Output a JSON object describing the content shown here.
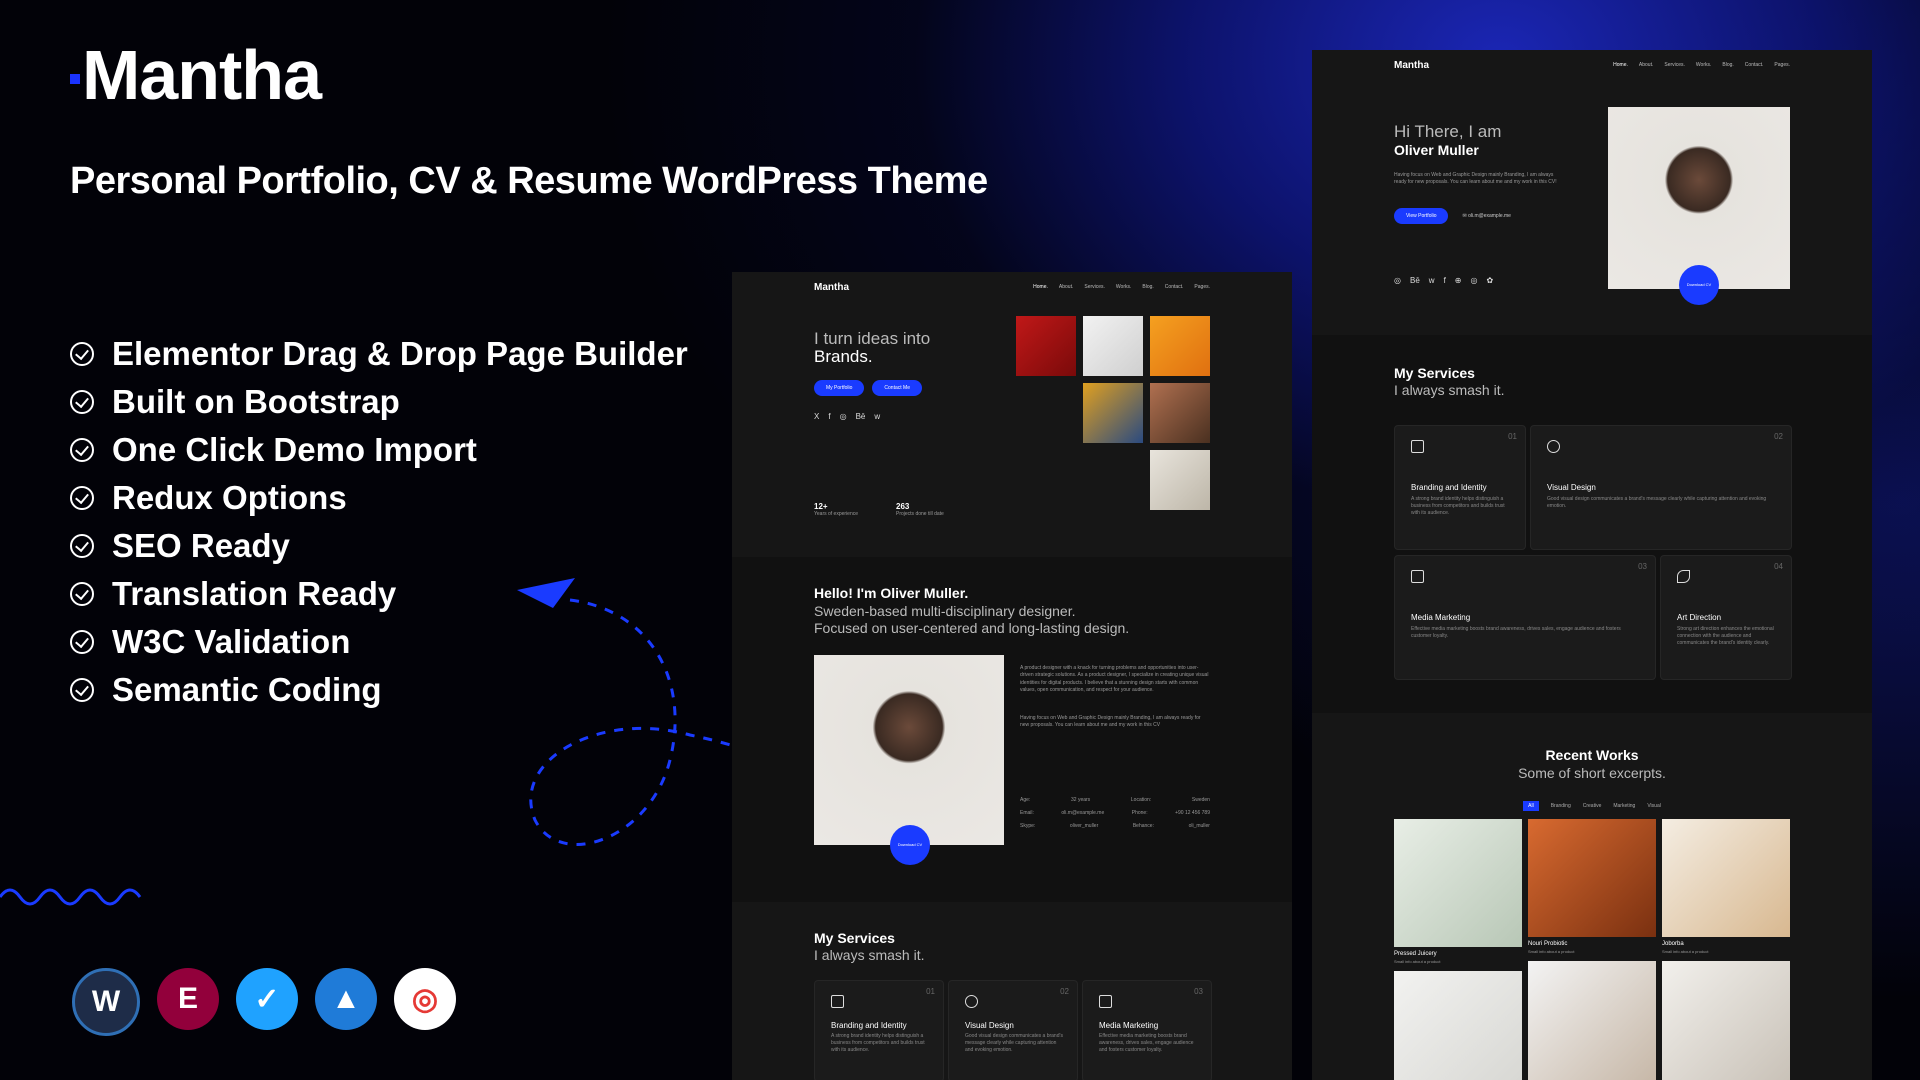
{
  "brand": {
    "name": "Mantha",
    "tagline": "Personal Portfolio, CV & Resume WordPress Theme"
  },
  "features": [
    "Elementor Drag & Drop Page Builder",
    "Built on Bootstrap",
    "One Click Demo Import",
    "Redux Options",
    "SEO Ready",
    "Translation Ready",
    "W3C Validation",
    "Semantic Coding"
  ],
  "plugins": [
    {
      "name": "wordpress-icon",
      "glyph": "W",
      "color": "#1e2c48"
    },
    {
      "name": "elementor-icon",
      "glyph": "E",
      "color": "#92003b"
    },
    {
      "name": "contact-form-icon",
      "glyph": "✓",
      "color": "#1fa2ff"
    },
    {
      "name": "mountain-icon",
      "glyph": "▲",
      "color": "#1f7bd8"
    },
    {
      "name": "click-icon",
      "glyph": "◎",
      "color": "#e53935"
    }
  ],
  "mid": {
    "nav": {
      "logo": "Mantha",
      "links": [
        "Home.",
        "About.",
        "Services.",
        "Works.",
        "Blog.",
        "Contact.",
        "Pages."
      ]
    },
    "hero": {
      "line1": "I turn ideas into",
      "line2": "Brands.",
      "btn_portfolio": "My Portfolio",
      "btn_contact": "Contact Me",
      "social": [
        "X",
        "f",
        "◎",
        "Bē",
        "w"
      ],
      "stat1_value": "12+",
      "stat1_label": "Years of experience",
      "stat2_value": "263",
      "stat2_label": "Projects done till date"
    },
    "about": {
      "title": "Hello! I'm Oliver Muller.",
      "subtitle1": "Sweden-based multi-disciplinary designer.",
      "subtitle2": "Focused on user-centered and long-lasting design.",
      "para1": "A product designer with a knack for turning problems and opportunities into user-driven strategic solutions. As a product designer, I specialize in creating unique visual identities for digital products. I believe that a stunning design starts with common values, open communication, and respect for your audience.",
      "para2": "Having focus on Web and Graphic Design mainly Branding, I am always ready for new proposals. You can learn about me and my work in this CV",
      "download": "Download CV",
      "info": [
        {
          "k": "Age:",
          "v": "32 years",
          "k2": "Location:",
          "v2": "Sweden"
        },
        {
          "k": "Email:",
          "v": "oli.m@example.me",
          "k2": "Phone:",
          "v2": "+90 12 456 789"
        },
        {
          "k": "Skype:",
          "v": "oliver_muller",
          "k2": "Behance:",
          "v2": "oli_muller"
        }
      ]
    },
    "services": {
      "title": "My Services",
      "subtitle": "I always smash it.",
      "cards": [
        {
          "num": "01",
          "title": "Branding and Identity",
          "desc": "A strong brand identity helps distinguish a business from competitors and builds trust with its audience."
        },
        {
          "num": "02",
          "title": "Visual Design",
          "desc": "Good visual design communicates a brand's message clearly while capturing attention and evoking emotion."
        },
        {
          "num": "03",
          "title": "Media Marketing",
          "desc": "Effective media marketing boosts brand awareness, drives sales, engage audience and fosters customer loyalty."
        }
      ]
    }
  },
  "right": {
    "nav": {
      "logo": "Mantha",
      "links": [
        "Home.",
        "About.",
        "Services.",
        "Works.",
        "Blog.",
        "Contact.",
        "Pages."
      ]
    },
    "hero": {
      "line1": "Hi There, I am",
      "line2": "Oliver Muller",
      "desc": "Having focus on Web and Graphic Design mainly Branding, I am always ready for new proposals. You can learn about me and my work in this CV!",
      "btn": "View Portfolio",
      "email": "oli.m@example.me",
      "social": [
        "◎",
        "Bē",
        "w",
        "f",
        "⊕",
        "◎",
        "✿"
      ],
      "download": "Download CV"
    },
    "services": {
      "title": "My Services",
      "subtitle": "I always smash it.",
      "cards": [
        {
          "num": "01",
          "title": "Branding and Identity",
          "desc": "A strong brand identity helps distinguish a business from competitors and builds trust with its audience."
        },
        {
          "num": "02",
          "title": "Visual Design",
          "desc": "Good visual design communicates a brand's message clearly while capturing attention and evoking emotion."
        },
        {
          "num": "03",
          "title": "Media Marketing",
          "desc": "Effective media marketing boosts brand awareness, drives sales, engage audience and fosters customer loyalty."
        },
        {
          "num": "04",
          "title": "Art Direction",
          "desc": "Strong art direction enhances the emotional connection with the audience and communicates the brand's identity clearly."
        }
      ]
    },
    "works": {
      "title": "Recent Works",
      "subtitle": "Some of short excerpts.",
      "filters": [
        "All",
        "Branding",
        "Creative",
        "Marketing",
        "Visual"
      ],
      "items": [
        {
          "title": "Pressed Juicery",
          "sub": "Small info about a product"
        },
        {
          "title": "Nouri Probiotic",
          "sub": "Small info about a product"
        },
        {
          "title": "Joborba",
          "sub": "Small info about a product"
        }
      ]
    }
  },
  "colors": {
    "accent": "#1a3bff",
    "bg": "#020208",
    "screen": "#161616"
  }
}
